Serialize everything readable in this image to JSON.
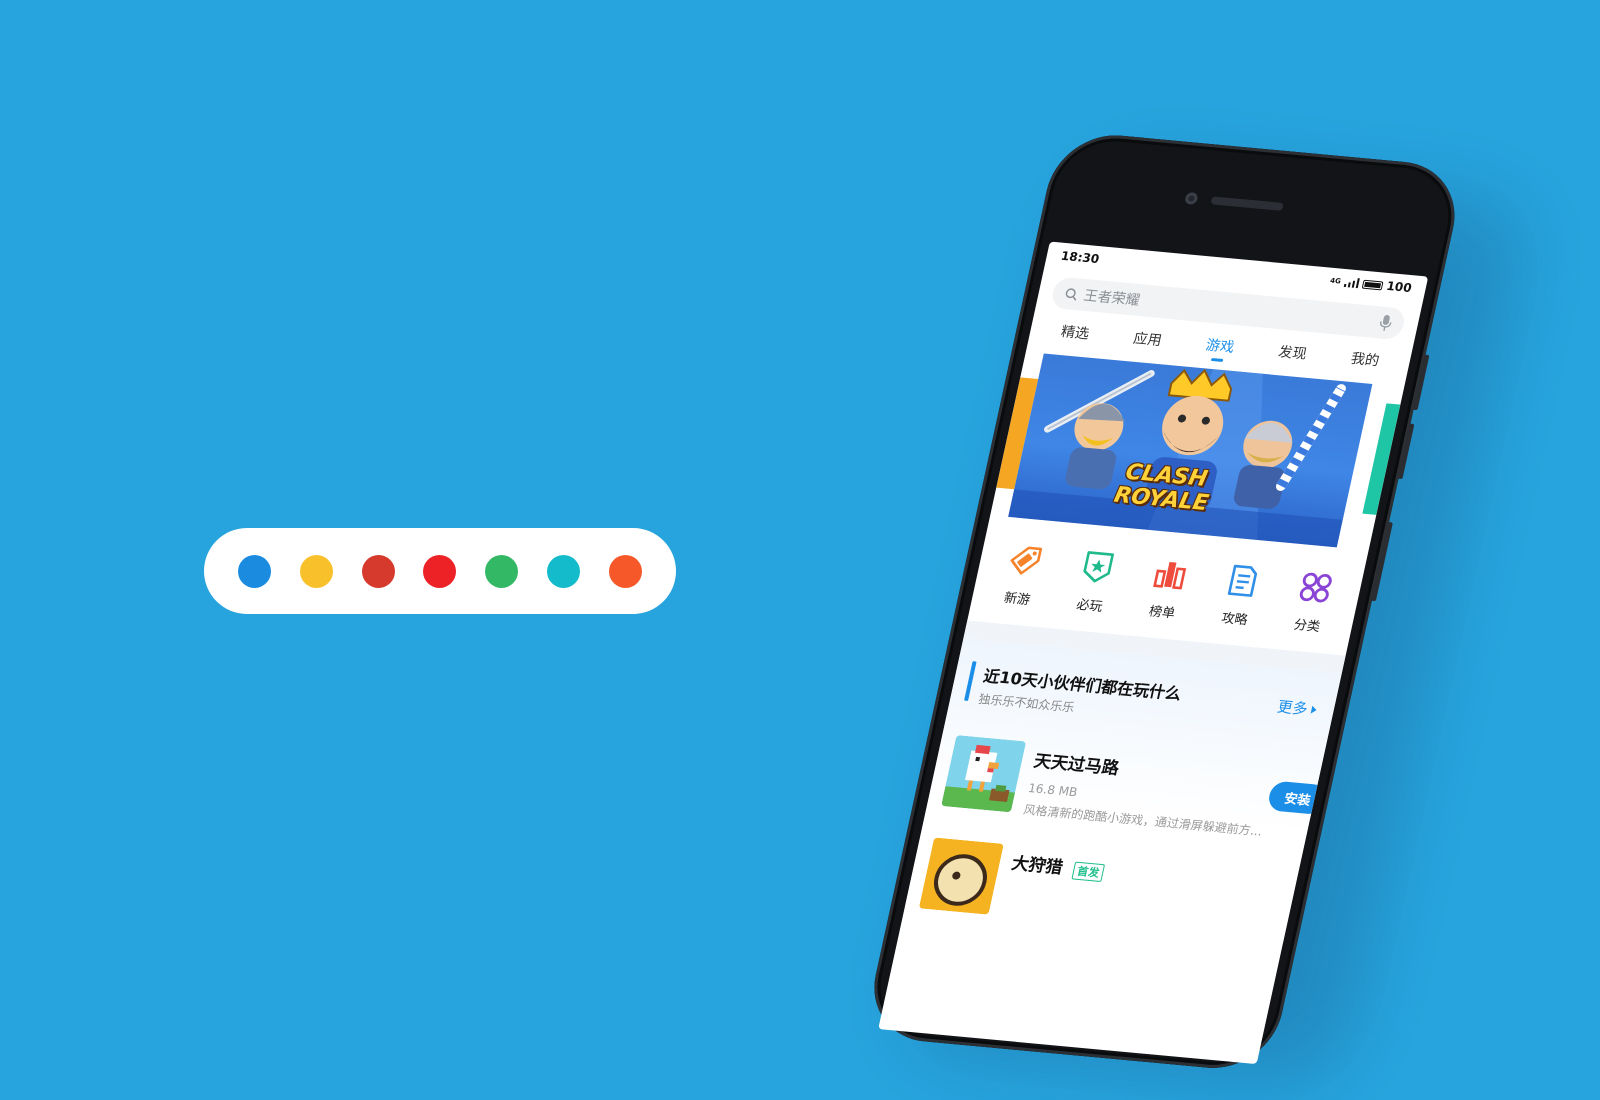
{
  "palette": {
    "colors": [
      "#1b8be0",
      "#f8c12b",
      "#d63a2c",
      "#ec2227",
      "#33b866",
      "#14bccb",
      "#f6582a"
    ]
  },
  "status_bar": {
    "time": "18:30",
    "network": "4G",
    "battery": "100"
  },
  "search": {
    "placeholder": "王者荣耀"
  },
  "tabs": [
    {
      "label": "精选",
      "active": false
    },
    {
      "label": "应用",
      "active": false
    },
    {
      "label": "游戏",
      "active": true
    },
    {
      "label": "发现",
      "active": false
    },
    {
      "label": "我的",
      "active": false
    }
  ],
  "banner": {
    "title_line1": "CLASH",
    "title_line2": "ROYALE"
  },
  "quick_links": [
    {
      "label": "新游",
      "icon": "new-tag-icon",
      "color": "#f6822a"
    },
    {
      "label": "必玩",
      "icon": "star-badge-icon",
      "color": "#1fb98c"
    },
    {
      "label": "榜单",
      "icon": "ranking-bars-icon",
      "color": "#ef4b3c"
    },
    {
      "label": "攻略",
      "icon": "guide-doc-icon",
      "color": "#2f8fe8"
    },
    {
      "label": "分类",
      "icon": "category-grid-icon",
      "color": "#8a44d6"
    }
  ],
  "section": {
    "title": "近10天小伙伴们都在玩什么",
    "subtitle": "独乐乐不如众乐乐",
    "more_label": "更多"
  },
  "apps": [
    {
      "name": "天天过马路",
      "size": "16.8 MB",
      "description": "风格清新的跑酷小游戏，通过滑屏躲避前方...",
      "action": "安装"
    },
    {
      "name": "大狩猎",
      "badge": "首发"
    }
  ]
}
